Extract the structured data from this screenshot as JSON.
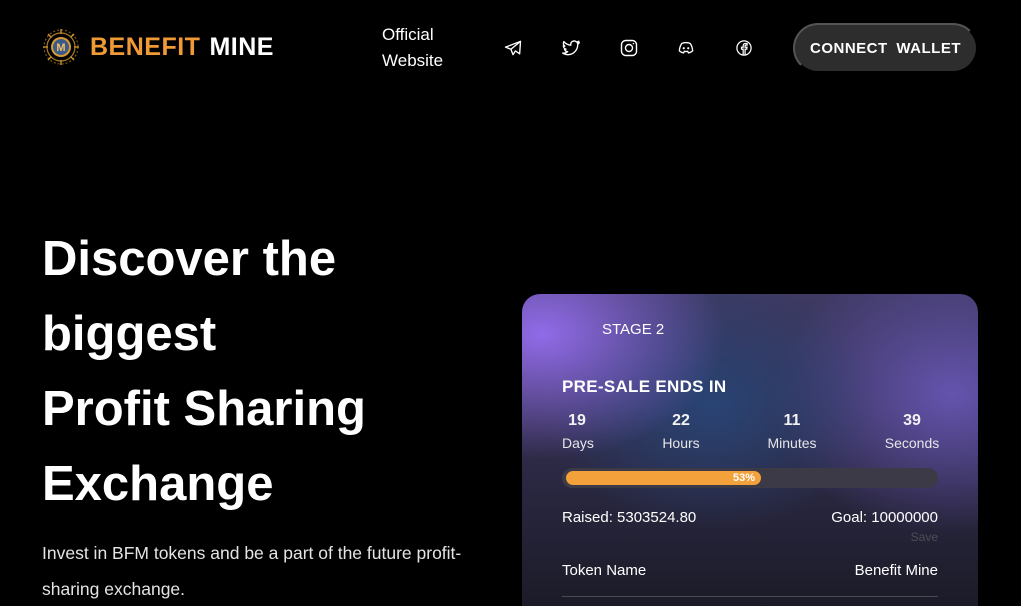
{
  "header": {
    "logo": {
      "word1": "BENEFIT",
      "word2": "MINE",
      "emblem_letter": "M"
    },
    "official_link": {
      "line1": "Official",
      "line2": "Website"
    },
    "social_icons": [
      "telegram-icon",
      "twitter-icon",
      "instagram-icon",
      "discord-icon",
      "facebook-icon"
    ],
    "connect_button": "CONNECT WALLET"
  },
  "hero": {
    "title_lines": [
      "Discover the",
      "biggest",
      "Profit Sharing",
      "Exchange"
    ],
    "description": "Invest in BFM tokens and be a part of the future profit-sharing exchange."
  },
  "presale": {
    "stage": "STAGE 2",
    "heading": "PRE-SALE ENDS IN",
    "countdown": [
      {
        "value": "19",
        "label": "Days"
      },
      {
        "value": "22",
        "label": "Hours"
      },
      {
        "value": "11",
        "label": "Minutes"
      },
      {
        "value": "39",
        "label": "Seconds"
      }
    ],
    "progress_percent": 53,
    "progress_label": "53%",
    "raised": "Raised: 5303524.80",
    "goal": "Goal: 10000000",
    "save_label": "Save",
    "token_name_label": "Token Name",
    "token_name_value": "Benefit Mine"
  },
  "colors": {
    "brand_orange": "#f09a36",
    "progress_fill": "#f3a13a",
    "button_bg": "#2d2d2d",
    "background": "#000000"
  }
}
